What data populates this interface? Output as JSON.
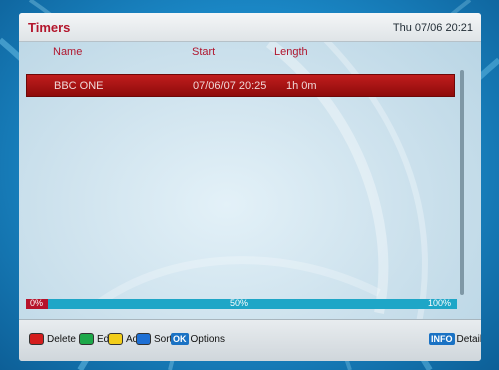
{
  "header": {
    "title": "Timers",
    "datetime": "Thu 07/06 20:21"
  },
  "columns": {
    "name": "Name",
    "start": "Start",
    "length": "Length"
  },
  "timers": [
    {
      "name": "BBC ONE",
      "start": "07/06/07  20:25",
      "length": "1h 0m"
    }
  ],
  "progress": {
    "min_label": "0%",
    "mid_label": "50%",
    "max_label": "100%",
    "value_percent": 5
  },
  "footer": {
    "delete": "Delete",
    "edit": "Edit",
    "add": "Add",
    "sort": "Sort",
    "ok_badge": "OK",
    "options": "Options",
    "info_badge": "INFO",
    "details": "Details"
  },
  "colors": {
    "title": "#b3162c",
    "selection": "#b01717",
    "progress_bar": "#1ea6c7",
    "red_key": "#d41d1d",
    "green_key": "#1da84a",
    "yellow_key": "#f2cd1a",
    "blue_key": "#1d6fd4"
  }
}
